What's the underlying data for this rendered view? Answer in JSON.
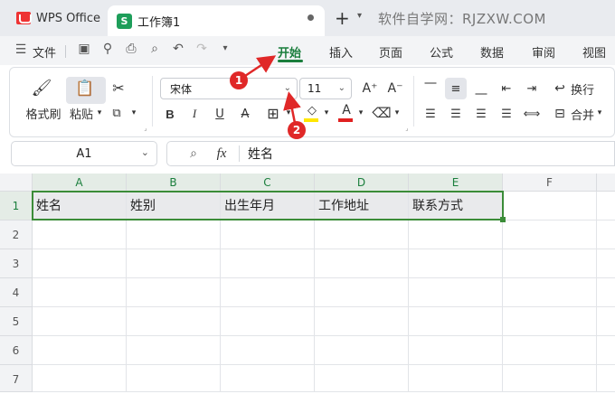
{
  "titlebar": {
    "app_tab": "WPS Office",
    "doc_tab": "工作簿1",
    "doc_logo": "S",
    "new_tab": "+",
    "watermark": "软件自学网：RJZXW.COM"
  },
  "menubar": {
    "file": "文件",
    "tabs": [
      "开始",
      "插入",
      "页面",
      "公式",
      "数据",
      "审阅",
      "视图"
    ],
    "active_tab": "开始",
    "accent_color": "#1a7e3c"
  },
  "ribbon": {
    "format_painter": "格式刷",
    "paste": "粘贴",
    "font_name": "宋体",
    "font_size": "11",
    "wrap_text": "换行",
    "merge": "合并",
    "bold": "B",
    "italic": "I",
    "underline": "U",
    "strike": "A",
    "font_color_letter": "A"
  },
  "formula_bar": {
    "name_box": "A1",
    "fx": "fx",
    "content": "姓名"
  },
  "sheet": {
    "columns": [
      "A",
      "B",
      "C",
      "D",
      "E",
      "F"
    ],
    "rows": [
      "1",
      "2",
      "3",
      "4",
      "5",
      "6",
      "7"
    ],
    "row1": [
      "姓名",
      "姓别",
      "出生年月",
      "工作地址",
      "联系方式"
    ]
  },
  "annotations": {
    "marker1": "1",
    "marker2": "2",
    "color": "#e02828"
  }
}
